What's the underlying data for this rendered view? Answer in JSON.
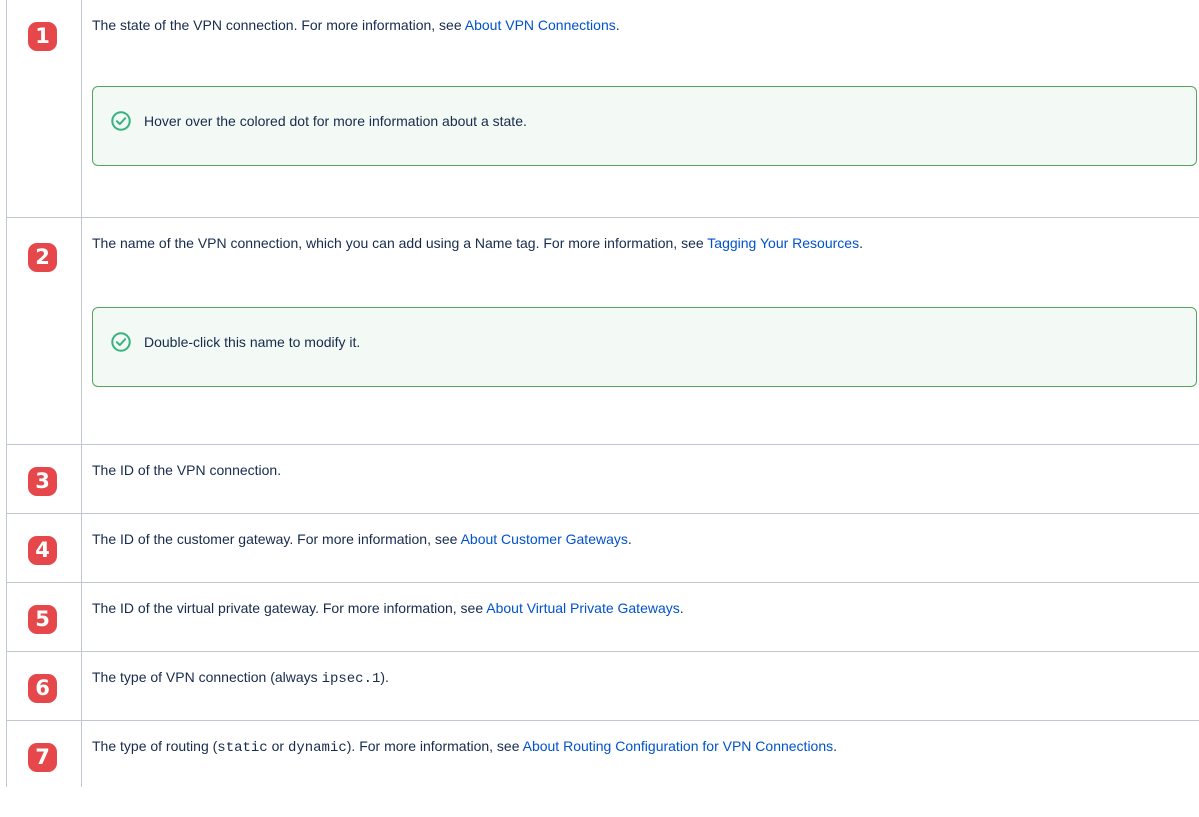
{
  "rows": [
    {
      "number": "1",
      "description": [
        {
          "text": "The state of the VPN connection. For more information, see "
        },
        {
          "text": "About VPN Connections",
          "link": true
        },
        {
          "text": "."
        }
      ],
      "note": {
        "icon": "check-circle-icon",
        "text": "Hover over the colored dot for more information about a state."
      }
    },
    {
      "number": "2",
      "description": [
        {
          "text": "The name of the VPN connection, which you can add using a Name tag. For more information, see "
        },
        {
          "text": "Tagging Your Resources",
          "link": true
        },
        {
          "text": "."
        }
      ],
      "note": {
        "icon": "check-circle-icon",
        "text": "Double-click this name to modify it."
      }
    },
    {
      "number": "3",
      "description": [
        {
          "text": "The ID of the VPN connection."
        }
      ]
    },
    {
      "number": "4",
      "description": [
        {
          "text": "The ID of the customer gateway. For more information, see "
        },
        {
          "text": "About Customer Gateways",
          "link": true
        },
        {
          "text": "."
        }
      ]
    },
    {
      "number": "5",
      "description": [
        {
          "text": "The ID of the virtual private gateway. For more information, see "
        },
        {
          "text": "About Virtual Private Gateways",
          "link": true
        },
        {
          "text": "."
        }
      ]
    },
    {
      "number": "6",
      "description": [
        {
          "text": "The type of VPN connection (always "
        },
        {
          "text": "ipsec.1",
          "code": true
        },
        {
          "text": ")."
        }
      ]
    },
    {
      "number": "7",
      "description": [
        {
          "text": "The type of routing ("
        },
        {
          "text": "static",
          "code": true
        },
        {
          "text": " or "
        },
        {
          "text": "dynamic",
          "code": true
        },
        {
          "text": "). For more information, see "
        },
        {
          "text": "About Routing Configuration for VPN Connections",
          "link": true
        },
        {
          "text": "."
        }
      ]
    }
  ],
  "colors": {
    "badge": "#e5474b",
    "link": "#0052cc",
    "note_border": "#57a55a",
    "note_background": "#f3f9f4",
    "text": "#172b4d",
    "table_border": "#c1c7d0"
  }
}
